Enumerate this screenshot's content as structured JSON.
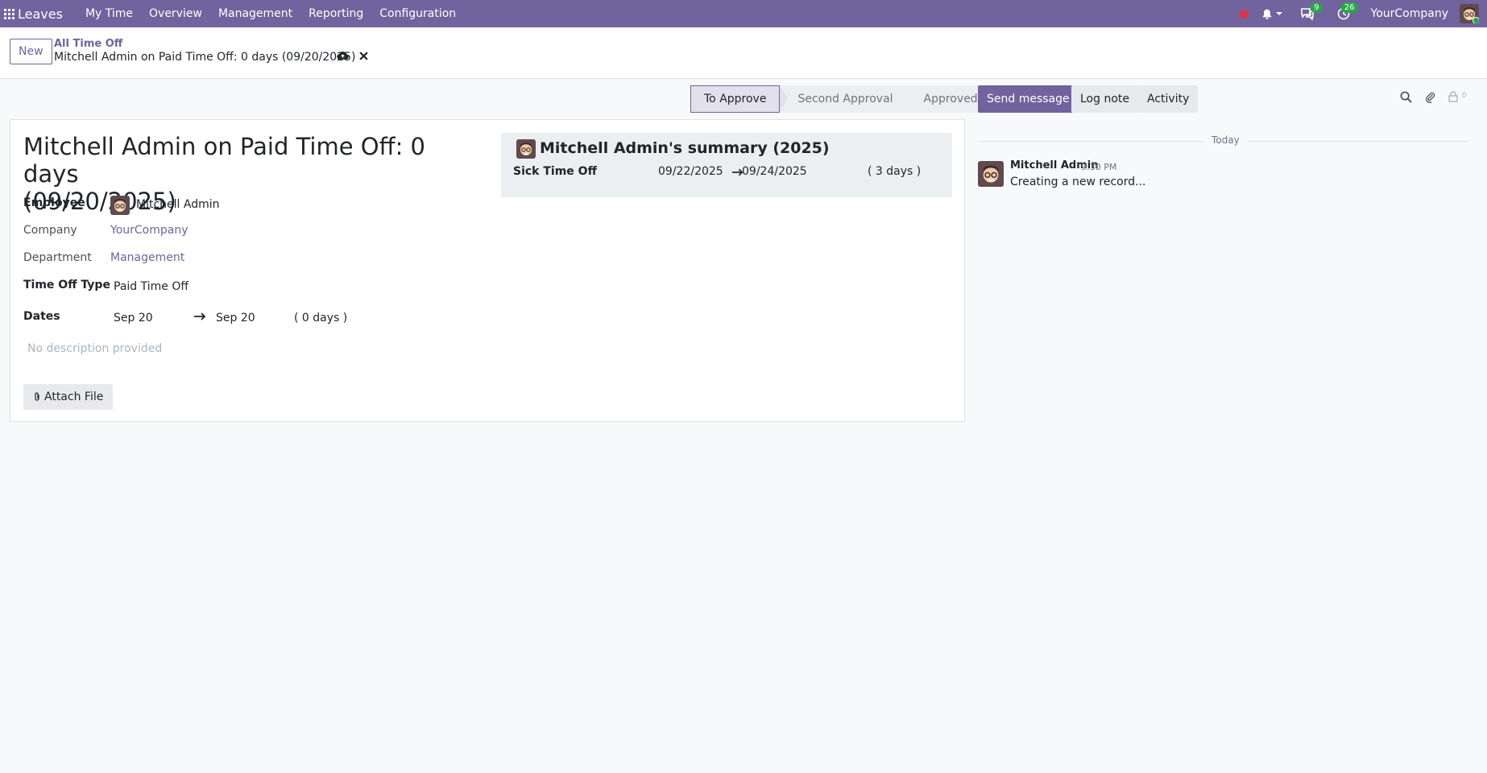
{
  "navbar": {
    "app_name": "Leaves",
    "menu": [
      "My Time",
      "Overview",
      "Management",
      "Reporting",
      "Configuration"
    ],
    "messages_count": "9",
    "activities_count": "26",
    "company": "YourCompany",
    "accent": "#71639e"
  },
  "control_panel": {
    "new_label": "New",
    "breadcrumb_parent": "All Time Off",
    "breadcrumb_current": "Mitchell Admin on Paid Time Off: 0 days (09/20/2025)"
  },
  "status_bar": {
    "stages": [
      "To Approve",
      "Second Approval",
      "Approved"
    ],
    "current": "To Approve"
  },
  "form": {
    "title_line1": "Mitchell Admin on Paid Time Off: 0 days",
    "title_line2": "(09/20/2025)",
    "employee_label": "Employee",
    "employee_value": "Mitchell Admin",
    "company_label": "Company",
    "company_value": "YourCompany",
    "department_label": "Department",
    "department_value": "Management",
    "type_label": "Time Off Type",
    "type_value": "Paid Time Off",
    "dates_label": "Dates",
    "date_from": "Sep 20",
    "date_to": "Sep 20",
    "duration": "( 0 days )",
    "description_placeholder": "No description provided",
    "attach_label": "Attach File"
  },
  "summary": {
    "title": "Mitchell Admin's summary (2025)",
    "rows": [
      {
        "type": "Sick Time Off",
        "from": "09/22/2025",
        "to": "09/24/2025",
        "duration": "( 3 days )"
      }
    ]
  },
  "chatter": {
    "send_message": "Send message",
    "log_note": "Log note",
    "activity": "Activity",
    "followers_count": "0",
    "separator": "Today",
    "messages": [
      {
        "author": "Mitchell Admin",
        "time": "9:30 PM",
        "body": "Creating a new record..."
      }
    ]
  }
}
